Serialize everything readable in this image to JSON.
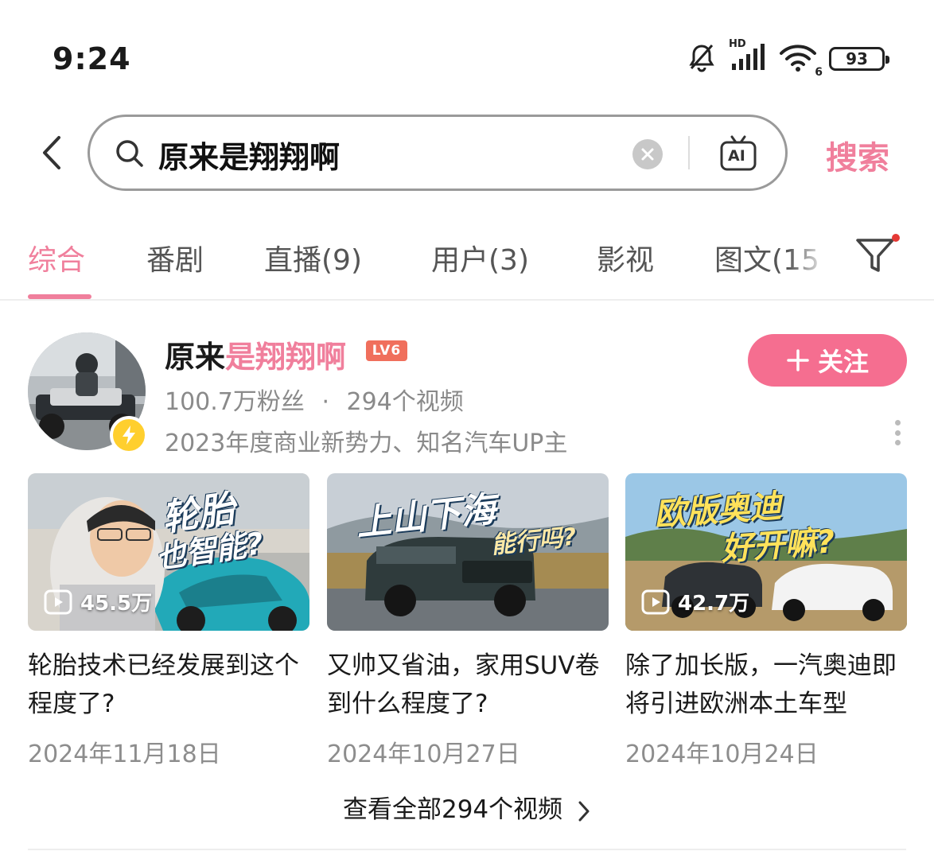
{
  "status_bar": {
    "time": "9:24",
    "network_label": "HD",
    "wifi_label": "6",
    "battery": "93"
  },
  "search": {
    "query": "原来是翔翔啊",
    "submit_label": "搜索",
    "ai_label": "AI"
  },
  "tabs": [
    {
      "label": "综合",
      "active": true
    },
    {
      "label": "番剧",
      "active": false
    },
    {
      "label": "直播(9)",
      "active": false
    },
    {
      "label": "用户(3)",
      "active": false
    },
    {
      "label": "影视",
      "active": false
    },
    {
      "label": "图文(15",
      "active": false
    }
  ],
  "user": {
    "name_prefix": "原来",
    "name_highlight": "是翔翔啊",
    "level": "LV6",
    "followers": "100.7万粉丝",
    "dot": "·",
    "videos": "294个视频",
    "description": "2023年度商业新势力、知名汽车UP主",
    "follow_label": "关注"
  },
  "videos": [
    {
      "overlay": [
        "轮胎",
        "也智能?"
      ],
      "play_count": "45.5万",
      "title": "轮胎技术已经发展到这个程度了?",
      "date": "2024年11月18日"
    },
    {
      "overlay": [
        "上山下海",
        "能行吗?"
      ],
      "play_count": "",
      "title": "又帅又省油，家用SUV卷到什么程度了?",
      "date": "2024年10月27日"
    },
    {
      "overlay": [
        "欧版奥迪",
        "好开嘛?"
      ],
      "play_count": "42.7万",
      "title": "除了加长版，一汽奥迪即将引进欧洲本土车型",
      "date": "2024年10月24日"
    }
  ],
  "see_all": "查看全部294个视频",
  "colors": {
    "accent_pink": "#f07f9c",
    "follow_button": "#f56e90",
    "secondary_text": "#8a8a8a"
  }
}
